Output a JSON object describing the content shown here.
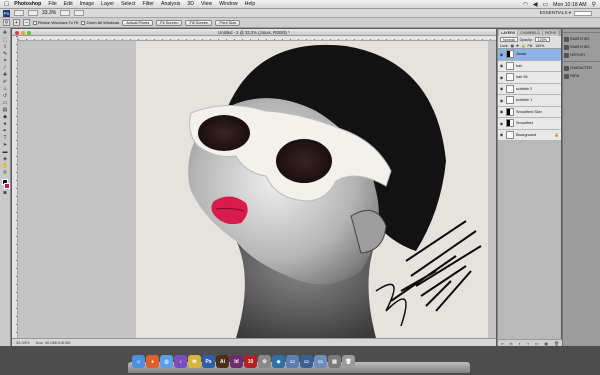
{
  "menubar": {
    "app_name": "Photoshop",
    "items": [
      "File",
      "Edit",
      "Image",
      "Layer",
      "Select",
      "Filter",
      "Analysis",
      "3D",
      "View",
      "Window",
      "Help"
    ],
    "clock": "Mon 10:18 AM"
  },
  "appbar": {
    "logo": "Ps",
    "zoom": "33.3%",
    "workspace": "ESSENTIALS ▾"
  },
  "options": {
    "resize_windows": "Resize Windows To Fit",
    "zoom_all": "Zoom All Windows",
    "buttons": [
      "Actual Pixels",
      "Fit Screen",
      "Fill Screen",
      "Print Size"
    ]
  },
  "document": {
    "title": "Untitled - 2 @ 33.3% (Jonas, RGB/8) *",
    "status_zoom": "33.33%",
    "status_doc": "Doc: 30.0M/108.3M"
  },
  "layers_panel": {
    "tabs": [
      "LAYERS",
      "CHANNELS",
      "PATHS"
    ],
    "blend_mode": "Normal",
    "opacity_label": "Opacity:",
    "opacity": "100%",
    "lock_label": "Lock:",
    "fill_label": "Fill:",
    "fill": "100%",
    "layers": [
      {
        "name": "Jonas",
        "thumb": "mask",
        "selected": true
      },
      {
        "name": "hair",
        "thumb": "plain",
        "selected": false
      },
      {
        "name": "hair 96",
        "thumb": "plain",
        "selected": false
      },
      {
        "name": "scribble 2",
        "thumb": "plain",
        "selected": false
      },
      {
        "name": "scribble 1",
        "thumb": "plain",
        "selected": false
      },
      {
        "name": "Smoothed Skin",
        "thumb": "mask",
        "selected": false
      },
      {
        "name": "Smoothed",
        "thumb": "mask",
        "selected": false
      },
      {
        "name": "Background",
        "thumb": "plain",
        "selected": false
      }
    ]
  },
  "dock_panels": {
    "group1": [
      "SWATCHES",
      "SWATCHES",
      "HISTORY"
    ],
    "group2": [
      "CHARACTER",
      "PARA"
    ]
  },
  "photo": {
    "lips_color": "#d81b4a",
    "skin_colors": [
      "#e0e0e0",
      "#9a9a9a",
      "#555555"
    ]
  }
}
